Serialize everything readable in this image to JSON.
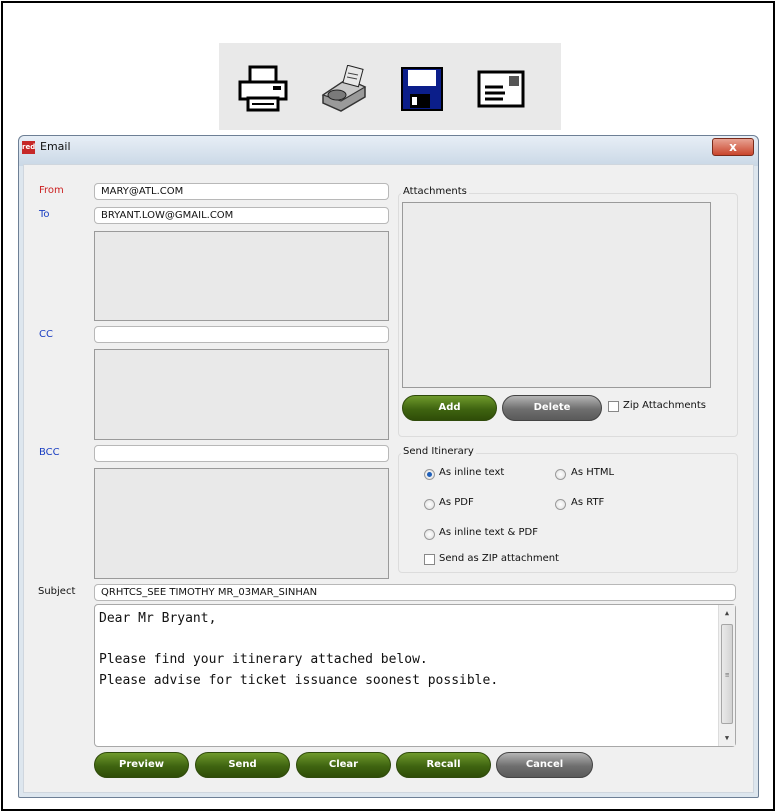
{
  "toolbar": {
    "icons": [
      "printer-icon",
      "fax-icon",
      "floppy-disk-icon",
      "envelope-icon"
    ]
  },
  "window": {
    "app_icon_text": "red",
    "title": "Email",
    "close_label": "x"
  },
  "form": {
    "from_label": "From",
    "from_value": "MARY@ATL.COM",
    "to_label": "To",
    "to_value": "BRYANT.LOW@GMAIL.COM",
    "cc_label": "CC",
    "cc_value": "",
    "bcc_label": "BCC",
    "bcc_value": "",
    "subject_label": "Subject",
    "subject_value": "QRHTCS_SEE TIMOTHY MR_03MAR_SINHAN",
    "body_lines": [
      "Dear Mr Bryant,",
      "",
      "Please find your itinerary attached below.",
      "Please advise for ticket issuance soonest possible."
    ]
  },
  "attachments": {
    "title": "Attachments",
    "add_label": "Add",
    "delete_label": "Delete",
    "zip_label": "Zip Attachments"
  },
  "itinerary": {
    "title": "Send Itinerary",
    "opt_inline": "As inline text",
    "opt_html": "As HTML",
    "opt_pdf": "As PDF",
    "opt_rtf": "As RTF",
    "opt_inline_pdf": "As inline text & PDF",
    "selected": "As inline text",
    "zip_label": "Send as ZIP attachment"
  },
  "buttons": {
    "preview": "Preview",
    "send": "Send",
    "clear": "Clear",
    "recall": "Recall",
    "cancel": "Cancel"
  },
  "colors": {
    "green_button": "#3f6410",
    "grey_button": "#6e6e6e",
    "label_red": "#cc2222",
    "label_blue": "#1a3ec2"
  }
}
